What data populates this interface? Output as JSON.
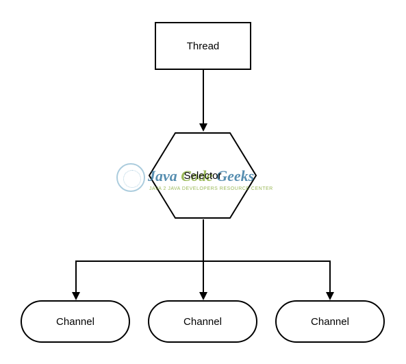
{
  "diagram": {
    "thread": "Thread",
    "selector": "Selector",
    "channels": [
      "Channel",
      "Channel",
      "Channel"
    ]
  },
  "watermark": {
    "word1": "Java",
    "word2": "Code",
    "word3": "Geeks",
    "subtitle": "JAVA 2 JAVA DEVELOPERS RESOURCE CENTER"
  },
  "chart_data": {
    "type": "diagram",
    "title": "",
    "nodes": [
      {
        "id": "thread",
        "label": "Thread",
        "shape": "rectangle"
      },
      {
        "id": "selector",
        "label": "Selector",
        "shape": "hexagon"
      },
      {
        "id": "channel1",
        "label": "Channel",
        "shape": "rounded-rectangle"
      },
      {
        "id": "channel2",
        "label": "Channel",
        "shape": "rounded-rectangle"
      },
      {
        "id": "channel3",
        "label": "Channel",
        "shape": "rounded-rectangle"
      }
    ],
    "edges": [
      {
        "from": "thread",
        "to": "selector",
        "directed": true
      },
      {
        "from": "selector",
        "to": "channel1",
        "directed": true
      },
      {
        "from": "selector",
        "to": "channel2",
        "directed": true
      },
      {
        "from": "selector",
        "to": "channel3",
        "directed": true
      }
    ]
  }
}
